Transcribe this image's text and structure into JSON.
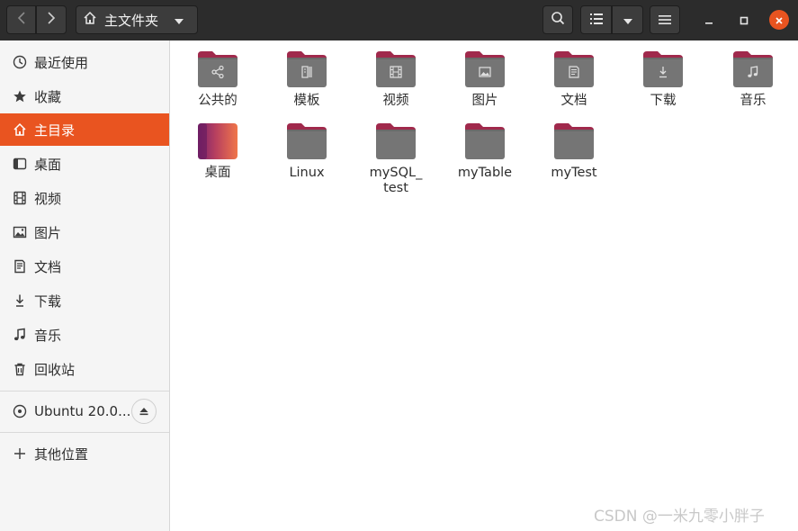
{
  "header": {
    "path_label": "主文件夹"
  },
  "sidebar": {
    "items": [
      {
        "label": "最近使用",
        "icon": "clock-icon"
      },
      {
        "label": "收藏",
        "icon": "star-icon"
      },
      {
        "label": "主目录",
        "icon": "home-icon",
        "active": true
      },
      {
        "label": "桌面",
        "icon": "desktop-icon"
      },
      {
        "label": "视频",
        "icon": "film-icon"
      },
      {
        "label": "图片",
        "icon": "image-icon"
      },
      {
        "label": "文档",
        "icon": "document-icon"
      },
      {
        "label": "下载",
        "icon": "download-icon"
      },
      {
        "label": "音乐",
        "icon": "music-icon"
      },
      {
        "label": "回收站",
        "icon": "trash-icon"
      }
    ],
    "devices": [
      {
        "label": "Ubuntu 20.0...",
        "icon": "disc-icon"
      }
    ],
    "other": {
      "label": "其他位置",
      "icon": "plus-icon"
    }
  },
  "files": [
    {
      "label": "公共的",
      "emblem": "share-icon"
    },
    {
      "label": "模板",
      "emblem": "template-icon"
    },
    {
      "label": "视频",
      "emblem": "film-icon"
    },
    {
      "label": "图片",
      "emblem": "image-icon"
    },
    {
      "label": "文档",
      "emblem": "document-icon"
    },
    {
      "label": "下载",
      "emblem": "download-icon"
    },
    {
      "label": "音乐",
      "emblem": "music-icon"
    },
    {
      "label": "桌面",
      "emblem": "desktop-folder-icon"
    },
    {
      "label": "Linux",
      "emblem": ""
    },
    {
      "label": "mySQL_ test",
      "emblem": ""
    },
    {
      "label": "myTable",
      "emblem": ""
    },
    {
      "label": "myTest",
      "emblem": ""
    }
  ],
  "colors": {
    "accent": "#e95420",
    "headerbar": "#2c2c2c",
    "folder_body": "#757575",
    "folder_tab": "#a0294c"
  },
  "watermark": "CSDN @一米九零小胖子"
}
